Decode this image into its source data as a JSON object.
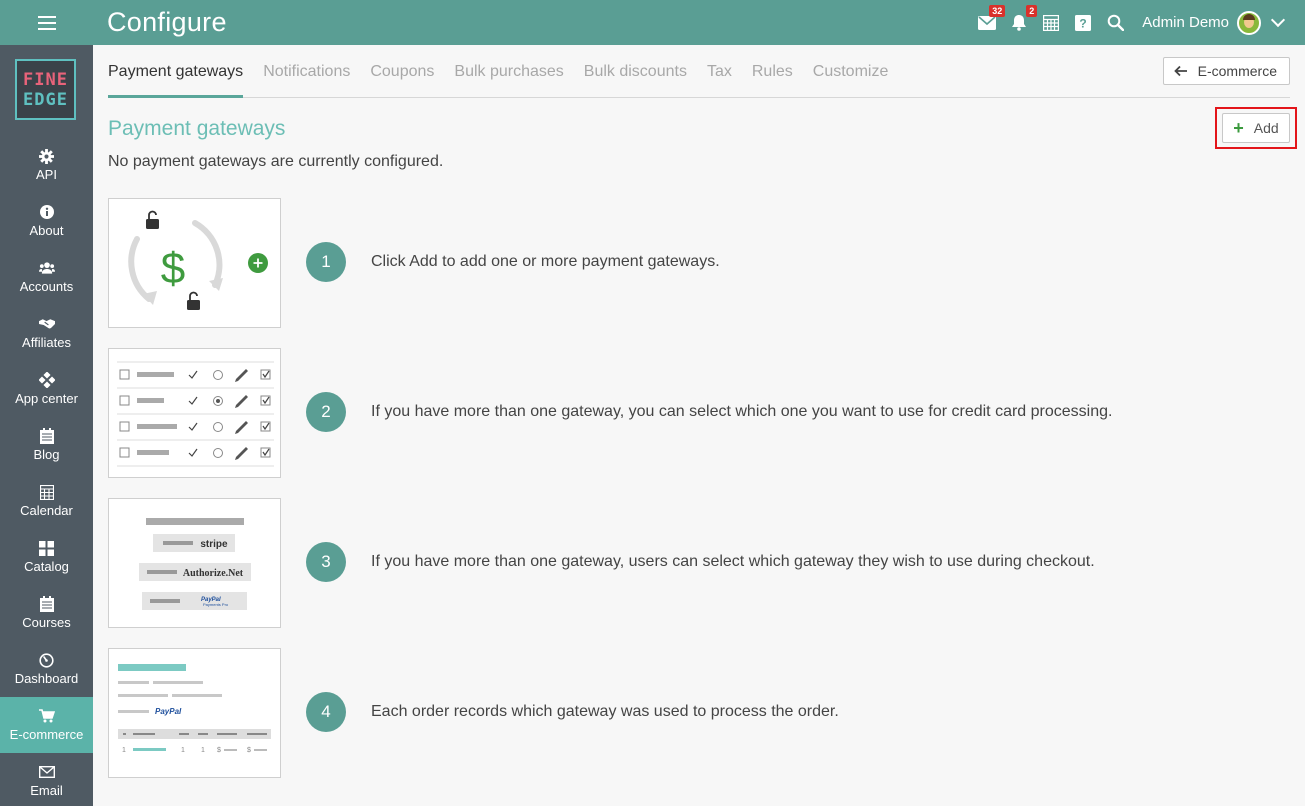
{
  "app": {
    "title": "Configure",
    "logo_line1": "FINE",
    "logo_line2": "EDGE"
  },
  "topbar": {
    "mail_badge": "32",
    "notif_badge": "2",
    "user_name": "Admin Demo",
    "icons": [
      "menu-icon",
      "mail-icon",
      "bell-icon",
      "calendar-grid-icon",
      "help-icon",
      "search-icon",
      "chevron-down-icon"
    ]
  },
  "sidebar": {
    "items": [
      {
        "label": "API",
        "icon": "gear-icon"
      },
      {
        "label": "About",
        "icon": "info-icon"
      },
      {
        "label": "Accounts",
        "icon": "users-icon"
      },
      {
        "label": "Affiliates",
        "icon": "handshake-icon"
      },
      {
        "label": "App center",
        "icon": "diamond-grid-icon"
      },
      {
        "label": "Blog",
        "icon": "blog-icon"
      },
      {
        "label": "Calendar",
        "icon": "calendar-icon"
      },
      {
        "label": "Catalog",
        "icon": "catalog-icon"
      },
      {
        "label": "Courses",
        "icon": "courses-icon"
      },
      {
        "label": "Dashboard",
        "icon": "dashboard-icon"
      },
      {
        "label": "E-commerce",
        "icon": "cart-icon",
        "active": true
      },
      {
        "label": "Email",
        "icon": "email-icon"
      }
    ]
  },
  "tabs": [
    {
      "label": "Payment gateways",
      "active": true
    },
    {
      "label": "Notifications"
    },
    {
      "label": "Coupons"
    },
    {
      "label": "Bulk purchases"
    },
    {
      "label": "Bulk discounts"
    },
    {
      "label": "Tax"
    },
    {
      "label": "Rules"
    },
    {
      "label": "Customize"
    }
  ],
  "back_button": "E-commerce",
  "section": {
    "title": "Payment gateways",
    "empty_message": "No payment gateways are currently configured.",
    "add_label": "Add"
  },
  "thumb_text": {
    "stripe": "stripe",
    "authorize": "Authorize.Net",
    "paypal_pro": "PayPal",
    "paypal_pro_sub": "Payments Pro",
    "paypal": "PayPal",
    "order_row": [
      "1",
      "1",
      "1",
      "$",
      "$"
    ]
  },
  "steps": [
    {
      "number": "1",
      "text": "Click Add to add one or more payment gateways."
    },
    {
      "number": "2",
      "text": "If you have more than one gateway, you can select which one you want to use for credit card processing."
    },
    {
      "number": "3",
      "text": "If you have more than one gateway, users can select which gateway they wish to use during checkout."
    },
    {
      "number": "4",
      "text": "Each order records which gateway was used to process the order."
    }
  ],
  "colors": {
    "topbar": "#5a9e94",
    "sidebar": "#4f5a63",
    "active_nav": "#5bb3a9",
    "accent_title": "#6cbeb5",
    "badge": "#d9312b",
    "highlight_border": "#e3151a"
  }
}
